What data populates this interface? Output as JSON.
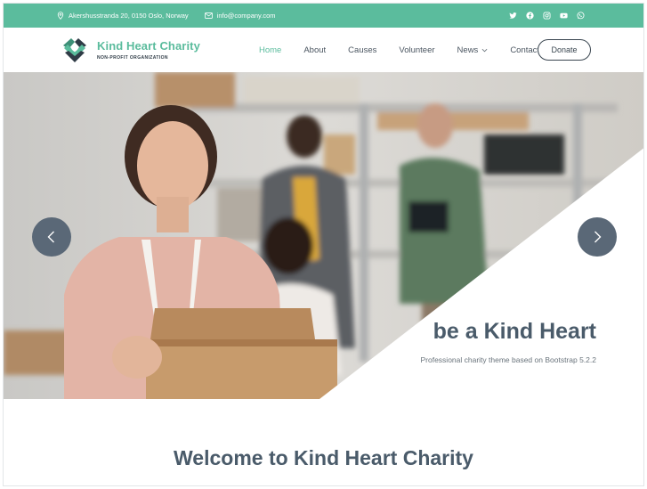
{
  "topbar": {
    "address": "Akershusstranda 20, 0150 Oslo, Norway",
    "email": "info@company.com",
    "address_icon": "location-pin-icon",
    "email_icon": "envelope-icon",
    "socials": [
      "twitter-icon",
      "facebook-icon",
      "instagram-icon",
      "youtube-icon",
      "whatsapp-icon"
    ]
  },
  "brand": {
    "title": "Kind Heart Charity",
    "subtitle": "NON-PROFIT ORGANIZATION",
    "logo_icon": "hands-heart-icon"
  },
  "nav": {
    "items": [
      {
        "label": "Home",
        "active": true
      },
      {
        "label": "About"
      },
      {
        "label": "Causes"
      },
      {
        "label": "Volunteer"
      },
      {
        "label": "News",
        "dropdown": true
      },
      {
        "label": "Contact"
      }
    ],
    "donate_label": "Donate"
  },
  "hero": {
    "title": "be a Kind Heart",
    "subtitle": "Professional charity theme based on Bootstrap 5.2.2",
    "prev_icon": "chevron-left-icon",
    "next_icon": "chevron-right-icon"
  },
  "welcome": {
    "title": "Welcome to Kind Heart Charity"
  },
  "colors": {
    "accent": "#5bbc9d",
    "dark": "#4a5b6a",
    "arrow_bg": "#5a6877"
  }
}
